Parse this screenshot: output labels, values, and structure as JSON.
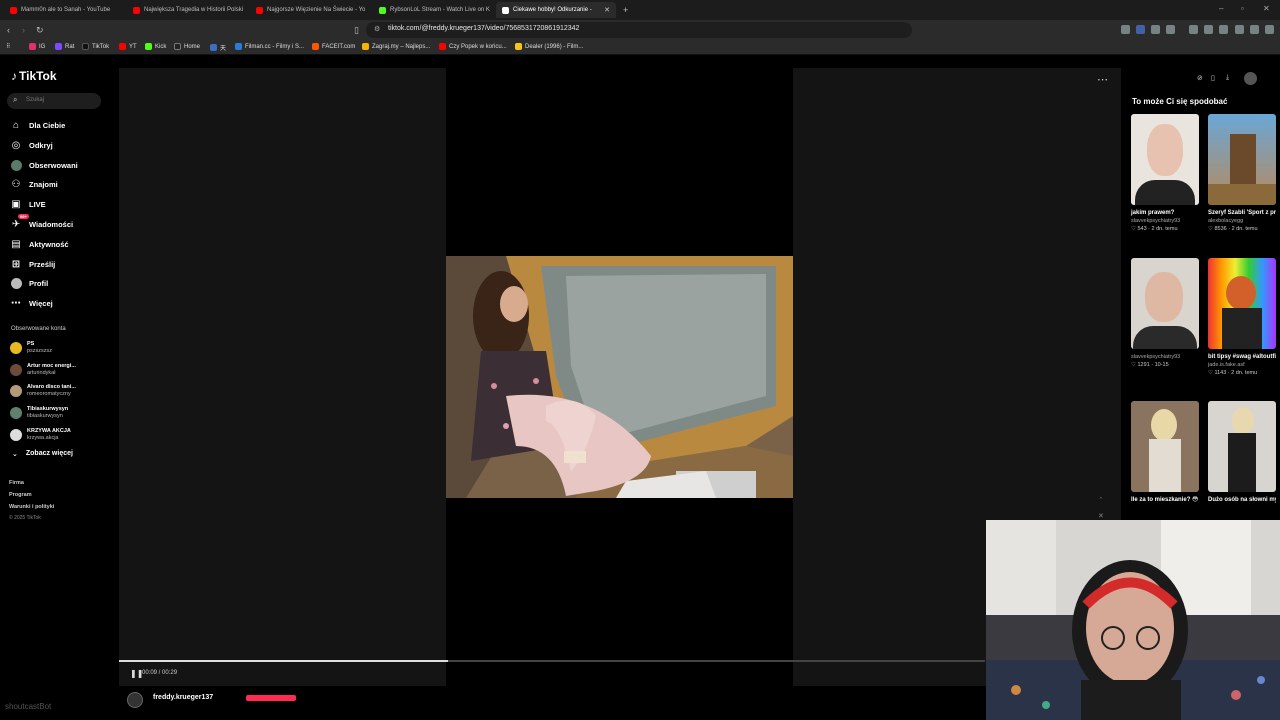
{
  "browser": {
    "tabs": [
      {
        "label": "Mamm0n ale to Sanah - YouTube",
        "color": "#ff0000"
      },
      {
        "label": "Największa Tragedia w Historii Polski",
        "color": "#ff0000"
      },
      {
        "label": "Najgorsze Więzienie Na Świecie - Yo",
        "color": "#ff0000"
      },
      {
        "label": "RybsonLoL Stream - Watch Live on K",
        "color": "#53fc18"
      },
      {
        "label": "Ciekawe hobby! Odkurzanie -",
        "color": "#ffffff",
        "active": true
      }
    ],
    "close_tab": "✕",
    "new_tab": "+",
    "url": "tiktok.com/@freddy.krueger137/video/7568531720861912342",
    "bookmarks": [
      {
        "label": "IG",
        "color": "#e1306c"
      },
      {
        "label": "Rat",
        "color": "#7b4bff"
      },
      {
        "label": "TikTok",
        "color": "#111111"
      },
      {
        "label": "YT",
        "color": "#ff0000"
      },
      {
        "label": "Kick",
        "color": "#53fc18"
      },
      {
        "label": "Home",
        "color": "#222222"
      },
      {
        "label": "天",
        "color": "#3a6fc4"
      },
      {
        "label": "Filman.cc - Filmy i S...",
        "color": "#2d7bd8"
      },
      {
        "label": "FACEIT.com",
        "color": "#ff5500"
      },
      {
        "label": "Zagraj.my – Najleps...",
        "color": "#f4b400"
      },
      {
        "label": "Czy Popek w końcu...",
        "color": "#ff0000"
      },
      {
        "label": "Dealer (1996) - Film...",
        "color": "#f5c518"
      }
    ]
  },
  "tiktok": {
    "logo": "TikTok",
    "search_placeholder": "Szukaj",
    "nav": [
      {
        "label": "Dla Ciebie",
        "icon": "home-icon"
      },
      {
        "label": "Odkryj",
        "icon": "compass-icon"
      },
      {
        "label": "Obserwowani",
        "icon": "following-icon"
      },
      {
        "label": "Znajomi",
        "icon": "friends-icon"
      },
      {
        "label": "LIVE",
        "icon": "live-icon"
      },
      {
        "label": "Wiadomości",
        "icon": "messages-icon",
        "badge": "99+"
      },
      {
        "label": "Aktywność",
        "icon": "activity-icon"
      },
      {
        "label": "Prześlij",
        "icon": "upload-icon"
      },
      {
        "label": "Profil",
        "icon": "profile-icon"
      },
      {
        "label": "Więcej",
        "icon": "more-icon"
      }
    ],
    "followed_title": "Obserwowane konta",
    "followed": [
      {
        "name": "PS",
        "handle": "pszszszsz"
      },
      {
        "name": "Artur moc energi...",
        "handle": "arturindykał"
      },
      {
        "name": "Alvaro disco tani...",
        "handle": "romeoromatyczny"
      },
      {
        "name": "Tibiaskurwysyn",
        "handle": "tibiaskurwysyn"
      },
      {
        "name": "KRZYWA AKCJA",
        "handle": "krzywa.akcja"
      }
    ],
    "see_more": "Zobacz więcej",
    "footer": [
      "Firma",
      "Program",
      "Warunki i polityki",
      "© 2025 TikTok"
    ],
    "player": {
      "time": "00:09 / 00:29",
      "progress": 0.38,
      "author": "freddy.krueger137"
    },
    "suggest_title": "To może Ci się spodobać",
    "suggestions": [
      {
        "title": "jakim prawem?",
        "user": "slavvekpsychiatry93",
        "stats": "♡ 543 · 2 dn. temu"
      },
      {
        "title": "Szeryf Szabli 'Sport z prime...' Szeryf na wolności #dzikizachód #viral...",
        "user": "alexbolacyegg",
        "stats": "♡ 8536 · 2 dn. temu"
      },
      {
        "title": "",
        "user": "slavvekpsychiatry93",
        "stats": "♡ 1291 · 10-15"
      },
      {
        "title": "bit tipsy #swag #altoutfits...",
        "user": "jade.is.fake.asf",
        "stats": "♡ 1143 · 2 dn. temu"
      },
      {
        "title": "Ile za to mieszkanie? 😳 | #viralvideo...",
        "user": "",
        "stats": ""
      },
      {
        "title": "Dużo osób na słowni myli...",
        "user": "",
        "stats": ""
      }
    ]
  },
  "overlay_handle": "shoutcastBot"
}
